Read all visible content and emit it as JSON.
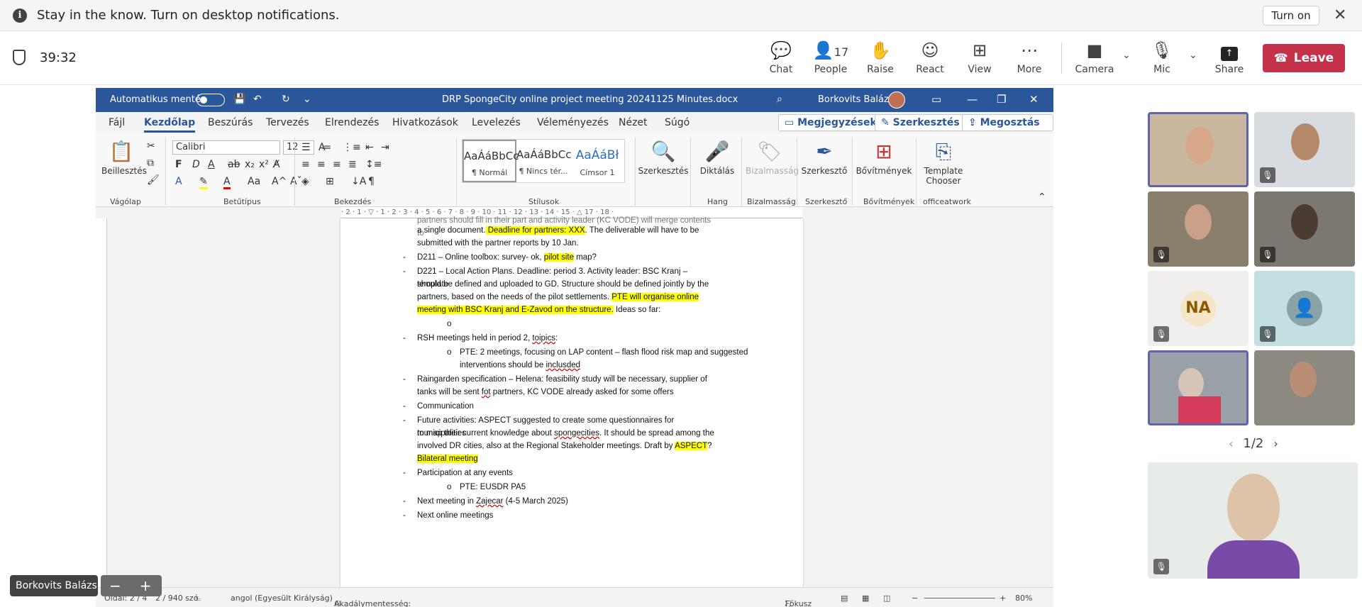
{
  "notification": {
    "message": "Stay in the know. Turn on desktop notifications.",
    "turn_on": "Turn on",
    "close": "✕",
    "info": "i"
  },
  "meeting": {
    "timer": "39:32"
  },
  "toolbar": {
    "chat": "Chat",
    "people": "People",
    "people_count": "17",
    "raise": "Raise",
    "react": "React",
    "view": "View",
    "more": "More",
    "camera": "Camera",
    "mic": "Mic",
    "share": "Share",
    "leave": "Leave"
  },
  "word": {
    "autosave": "Automatikus mentés",
    "doc_title": "DRP SpongeCity online project meeting 20241125 Minutes.docx",
    "user": "Borkovits Balázs",
    "menu": [
      "Fájl",
      "Kezdőlap",
      "Beszúrás",
      "Tervezés",
      "Elrendezés",
      "Hivatkozások",
      "Levelezés",
      "Véleményezés",
      "Nézet",
      "Súgó"
    ],
    "comments": "Megjegyzések",
    "editing": "Szerkesztés",
    "share": "Megosztás",
    "ribbon": {
      "paste": "Beillesztés",
      "clipboard": "Vágólap",
      "font": "Calibri",
      "size": "12",
      "font_group": "Betűtípus",
      "paragraph": "Bekezdés",
      "styles_group": "Stílusok",
      "style1_preview": "AaÁáBbCc",
      "style1": "¶ Normál",
      "style2_preview": "AaÁáBbCc",
      "style2": "¶ Nincs tér...",
      "style3_preview": "AaÁáBł",
      "style3": "Címsor 1",
      "find": "Szerkesztés",
      "dictate": "Diktálás",
      "voice": "Hang",
      "sensitivity": "Bizalmasság",
      "sensitivity_group": "Bizalmasság",
      "editor": "Szerkesztő",
      "editor_group": "Szerkesztő",
      "addins": "Bővítmények",
      "addins_group": "Bővítmények",
      "template": "Template Chooser",
      "template_group": "officeatwork"
    },
    "ruler": "· 2 · 1 · ▽ · 1 · 2 · 3 · 4 · 5 · 6 · 7 · 8 · 9 · 10 · 11 · 12 · 13 · 14 · 15 · △ 17 · 18 ·",
    "doc": {
      "l0": "partners should fill in their part and activity leader (KC VODE) will merge contents to",
      "l1a": "a single document.",
      "l1b": " Deadline for partners: XXX",
      ". ": "",
      "l1c": ". The deliverable will have to be",
      "l2": "submitted with the partner reports by 10 Jan.",
      "l3a": "D211 – Online toolbox: survey- ok, ",
      "l3b": "pilot site",
      "l3c": " map?",
      "l4": "D221 – Local Action Plans. Deadline: period 3. Activity leader: BSC Kranj – template",
      "l5": "should be defined and uploaded to GD. Structure should be defined jointly by the",
      "l6a": "partners, based on the needs of the pilot settlements. ",
      "l6b": "PTE will organise online",
      "l7a": "meeting with BSC Kranj and E-Zavod on the  structure.",
      "l7b": " Ideas so far:",
      "l8": "o",
      "l9a": "RSH meetings held in period 2, ",
      "l9b": "toipics",
      ":": "",
      "l9c": ":",
      "l10": "o",
      "l10t": "PTE: 2 meetings, focusing on LAP content – flash flood risk map and suggested",
      "l11a": "interventions should be ",
      "l11b": "inclusded",
      "l12": "Raingarden specification – Helena: feasibility study will be necessary, supplier of",
      "l13a": "tanks will be sent ",
      "l13b": "fot",
      "l13c": " partners, KC VODE already asked for some offers",
      "l14": "Communication",
      "l15": "Future activities: ASPECT suggested to create some questionnaires for municipalities",
      "l16a": "to map their current knowledge about ",
      "l16b": "spongecities",
      "l16c": ". It should be spread among the",
      "l17a": "involved DR cities, also at the Regional Stakeholder meetings. Draft by ",
      "l17b": "ASPECT",
      "l17c": "?",
      "l18": "Bilateral meeting",
      "l19": "Participation at any events",
      "l20": "o",
      "l20t": "PTE: EUSDR PA5",
      "l21a": "Next meeting in ",
      "l21b": "Zajecar",
      "l21c": " (4-5 March 2025)",
      "l22": "Next online meetings",
      "dash": "-"
    },
    "status": {
      "page": "Oldal: 2 / 4",
      "words": "2 / 940 szó",
      "lang": "angol (Egyesült Királyság)",
      "access": "Akadálymentesség: módosítás javasolt",
      "focus": "Fókusz",
      "zoom": "80%"
    }
  },
  "participants": {
    "na_initials": "NA",
    "pager": "1/2",
    "self_name": "Borkovits Balázs"
  }
}
